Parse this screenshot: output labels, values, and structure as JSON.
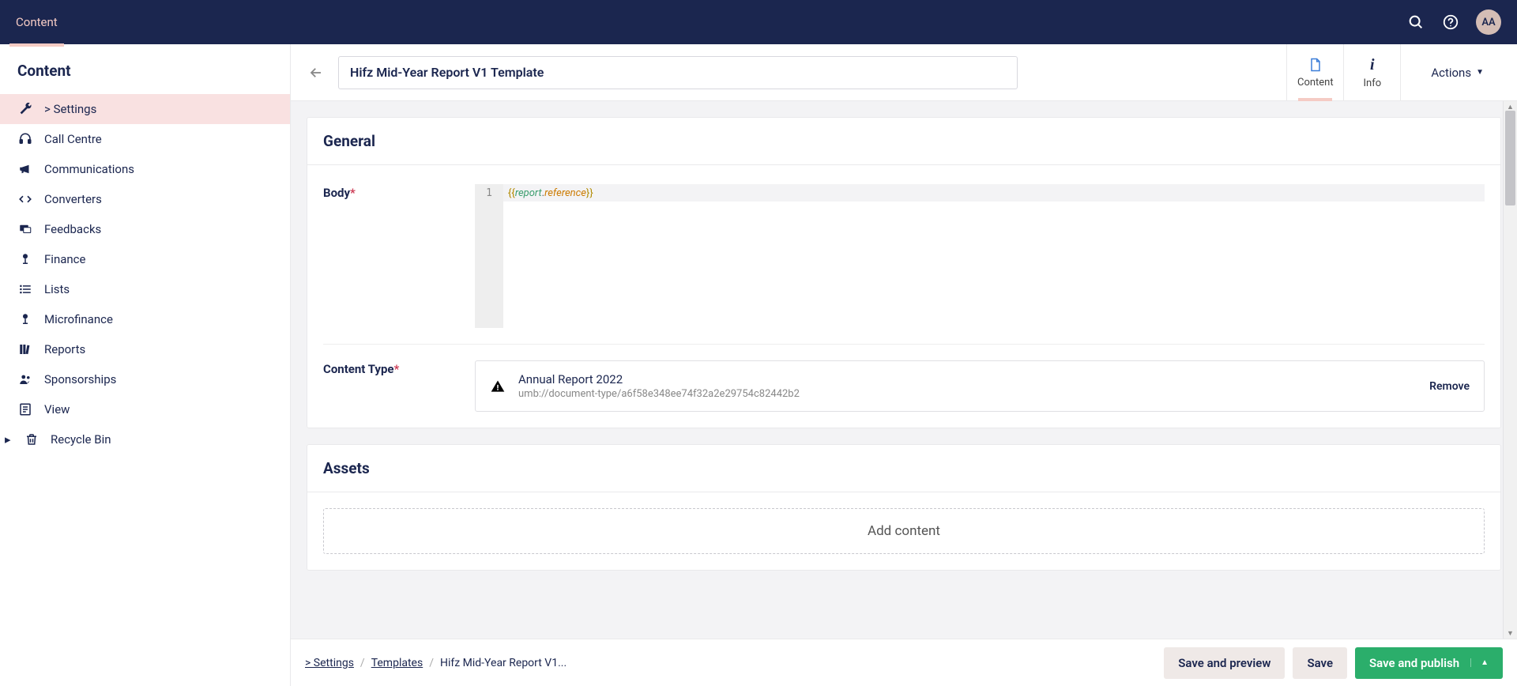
{
  "topbar": {
    "tab_label": "Content",
    "avatar_initials": "AA"
  },
  "sidebar": {
    "header": "Content",
    "items": [
      {
        "label": "> Settings",
        "icon": "wrench"
      },
      {
        "label": "Call Centre",
        "icon": "headset"
      },
      {
        "label": "Communications",
        "icon": "megaphone"
      },
      {
        "label": "Converters",
        "icon": "code"
      },
      {
        "label": "Feedbacks",
        "icon": "feedback"
      },
      {
        "label": "Finance",
        "icon": "lamp"
      },
      {
        "label": "Lists",
        "icon": "list"
      },
      {
        "label": "Microfinance",
        "icon": "lamp"
      },
      {
        "label": "Reports",
        "icon": "books"
      },
      {
        "label": "Sponsorships",
        "icon": "people"
      },
      {
        "label": "View",
        "icon": "doc"
      },
      {
        "label": "Recycle Bin",
        "icon": "trash"
      }
    ]
  },
  "editor": {
    "title_value": "Hifz Mid-Year Report V1 Template",
    "tabs": {
      "content": "Content",
      "info": "Info"
    },
    "actions_label": "Actions"
  },
  "panels": {
    "general": {
      "title": "General",
      "body_label": "Body",
      "body_code": {
        "open": "{{",
        "var1": "report",
        "dot": ".",
        "var2": "reference",
        "close": "}}",
        "line_no": "1"
      },
      "content_type_label": "Content Type",
      "content_type": {
        "title": "Annual Report 2022",
        "sub": "umb://document-type/a6f58e348ee74f32a2e29754c82442b2",
        "remove": "Remove"
      }
    },
    "assets": {
      "title": "Assets",
      "add_label": "Add content"
    }
  },
  "footer": {
    "breadcrumb": [
      "> Settings",
      "Templates",
      "Hifz Mid-Year Report V1..."
    ],
    "save_preview": "Save and preview",
    "save": "Save",
    "save_publish": "Save and publish"
  }
}
